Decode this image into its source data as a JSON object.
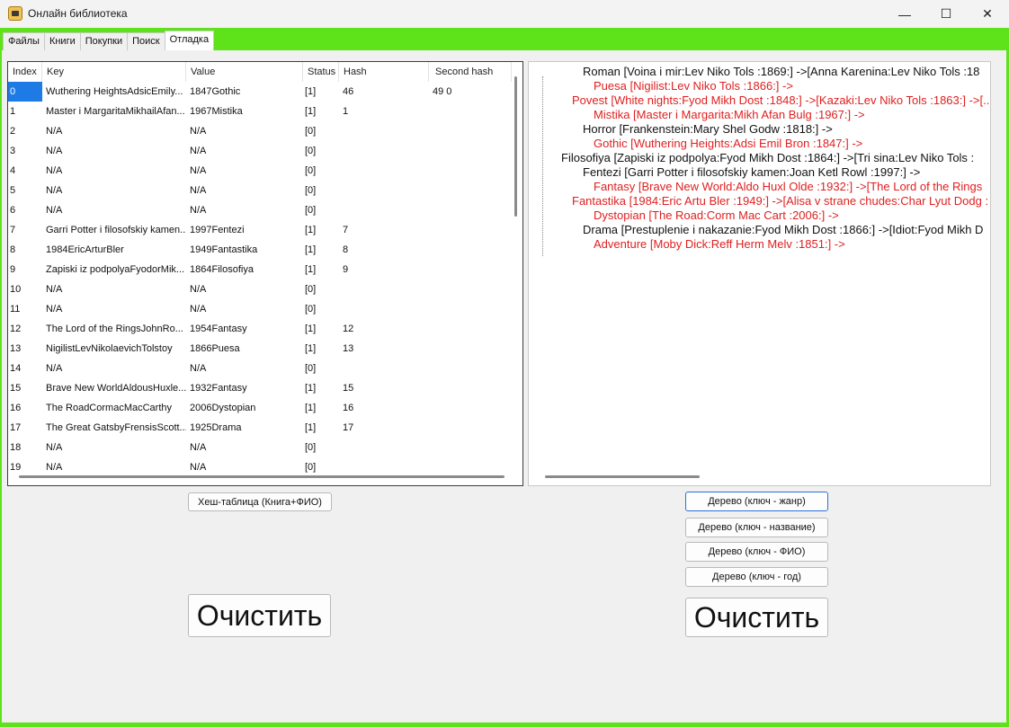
{
  "window": {
    "title": "Онлайн библиотека",
    "minimize_symbol": "—",
    "maximize_symbol": "☐",
    "close_symbol": "✕",
    "accent_color": "#5ee21a"
  },
  "tabs": [
    {
      "label": "Файлы"
    },
    {
      "label": "Книги"
    },
    {
      "label": "Покупки"
    },
    {
      "label": "Поиск"
    },
    {
      "label": "Отладка"
    }
  ],
  "grid": {
    "columns": [
      "Index",
      "Key",
      "Value",
      "Status",
      "Hash",
      "Second hash"
    ],
    "rows": [
      {
        "index": "0",
        "key": "Wuthering HeightsAdsicEmily...",
        "value": "1847Gothic",
        "status": "[1]",
        "hash": "46",
        "second": "49 0"
      },
      {
        "index": "1",
        "key": "Master i MargaritaMikhailAfan...",
        "value": "1967Mistika",
        "status": "[1]",
        "hash": "1",
        "second": ""
      },
      {
        "index": "2",
        "key": "N/A",
        "value": "N/A",
        "status": "[0]",
        "hash": "",
        "second": ""
      },
      {
        "index": "3",
        "key": "N/A",
        "value": "N/A",
        "status": "[0]",
        "hash": "",
        "second": ""
      },
      {
        "index": "4",
        "key": "N/A",
        "value": "N/A",
        "status": "[0]",
        "hash": "",
        "second": ""
      },
      {
        "index": "5",
        "key": "N/A",
        "value": "N/A",
        "status": "[0]",
        "hash": "",
        "second": ""
      },
      {
        "index": "6",
        "key": "N/A",
        "value": "N/A",
        "status": "[0]",
        "hash": "",
        "second": ""
      },
      {
        "index": "7",
        "key": "Garri Potter i filosofskiy kamen...",
        "value": "1997Fentezi",
        "status": "[1]",
        "hash": "7",
        "second": ""
      },
      {
        "index": "8",
        "key": "1984EricArturBler",
        "value": "1949Fantastika",
        "status": "[1]",
        "hash": "8",
        "second": ""
      },
      {
        "index": "9",
        "key": "Zapiski iz podpolyaFyodorMik...",
        "value": "1864Filosofiya",
        "status": "[1]",
        "hash": "9",
        "second": ""
      },
      {
        "index": "10",
        "key": "N/A",
        "value": "N/A",
        "status": "[0]",
        "hash": "",
        "second": ""
      },
      {
        "index": "11",
        "key": "N/A",
        "value": "N/A",
        "status": "[0]",
        "hash": "",
        "second": ""
      },
      {
        "index": "12",
        "key": "The Lord of the RingsJohnRo...",
        "value": "1954Fantasy",
        "status": "[1]",
        "hash": "12",
        "second": ""
      },
      {
        "index": "13",
        "key": "NigilistLevNikolaevichTolstoy",
        "value": "1866Puesa",
        "status": "[1]",
        "hash": "13",
        "second": ""
      },
      {
        "index": "14",
        "key": "N/A",
        "value": "N/A",
        "status": "[0]",
        "hash": "",
        "second": ""
      },
      {
        "index": "15",
        "key": "Brave New WorldAldousHuxle...",
        "value": "1932Fantasy",
        "status": "[1]",
        "hash": "15",
        "second": ""
      },
      {
        "index": "16",
        "key": "The RoadCormacMacCarthy",
        "value": "2006Dystopian",
        "status": "[1]",
        "hash": "16",
        "second": ""
      },
      {
        "index": "17",
        "key": "The Great GatsbyFrensisScott...",
        "value": "1925Drama",
        "status": "[1]",
        "hash": "17",
        "second": ""
      },
      {
        "index": "18",
        "key": "N/A",
        "value": "N/A",
        "status": "[0]",
        "hash": "",
        "second": ""
      },
      {
        "index": "19",
        "key": "N/A",
        "value": "N/A",
        "status": "[0]",
        "hash": "",
        "second": ""
      }
    ]
  },
  "tree": {
    "black_color": "#111111",
    "red_color": "#e02020",
    "lines": [
      {
        "text": "Roman [Voina i mir:Lev Niko Tols :1869:] ->[Anna Karenina:Lev Niko Tols :18",
        "color": "black"
      },
      {
        "text": "Puesa [Nigilist:Lev Niko Tols :1866:] ->",
        "color": "red"
      },
      {
        "text": "Povest [White nights:Fyod Mikh Dost :1848:] ->[Kazaki:Lev Niko Tols :1863:] ->[...",
        "color": "red"
      },
      {
        "text": "Mistika [Master i Margarita:Mikh Afan Bulg :1967:] ->",
        "color": "red"
      },
      {
        "text": "Horror [Frankenstein:Mary Shel Godw :1818:] ->",
        "color": "black"
      },
      {
        "text": "Gothic [Wuthering Heights:Adsi Emil Bron :1847:] ->",
        "color": "red"
      },
      {
        "text": "Filosofiya [Zapiski iz podpolya:Fyod Mikh Dost :1864:] ->[Tri sina:Lev Niko Tols :",
        "color": "black"
      },
      {
        "text": "Fentezi [Garri Potter i filosofskiy kamen:Joan Ketl Rowl :1997:] ->",
        "color": "black"
      },
      {
        "text": "Fantasy [Brave New World:Aldo Huxl Olde :1932:] ->[The Lord of the Rings",
        "color": "red"
      },
      {
        "text": "Fantastika [1984:Eric Artu Bler :1949:] ->[Alisa v strane chudes:Char Lyut Dodg :",
        "color": "red"
      },
      {
        "text": "Dystopian [The Road:Corm Mac Cart :2006:] ->",
        "color": "red"
      },
      {
        "text": "Drama [Prestuplenie i nakazanie:Fyod Mikh Dost :1866:] ->[Idiot:Fyod Mikh D",
        "color": "black"
      },
      {
        "text": "Adventure [Moby Dick:Reff Herm Melv :1851:] ->",
        "color": "red"
      }
    ]
  },
  "buttons": {
    "hash_table": "Хеш-таблица (Книга+ФИО)",
    "clear_left": "Очистить",
    "tree_genre": "Дерево (ключ - жанр)",
    "tree_title": "Дерево (ключ - название)",
    "tree_author": "Дерево (ключ - ФИО)",
    "tree_year": "Дерево (ключ - год)",
    "clear_right": "Очистить"
  }
}
